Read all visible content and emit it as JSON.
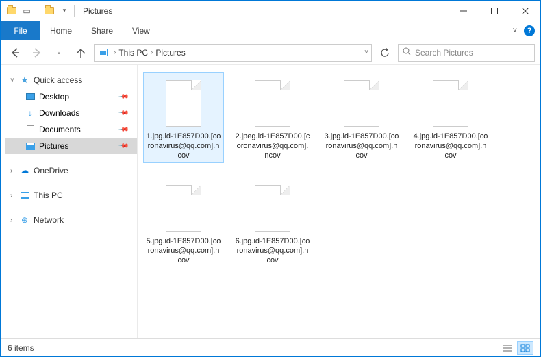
{
  "titlebar": {
    "title": "Pictures",
    "separator": "|"
  },
  "ribbon": {
    "file": "File",
    "tabs": [
      "Home",
      "Share",
      "View"
    ]
  },
  "breadcrumb": {
    "parts": [
      "This PC",
      "Pictures"
    ],
    "sep": "›"
  },
  "search": {
    "placeholder": "Search Pictures"
  },
  "sidebar": {
    "quick_access": "Quick access",
    "items": [
      {
        "label": "Desktop",
        "pinned": true
      },
      {
        "label": "Downloads",
        "pinned": true
      },
      {
        "label": "Documents",
        "pinned": true
      },
      {
        "label": "Pictures",
        "pinned": true,
        "selected": true
      }
    ],
    "onedrive": "OneDrive",
    "this_pc": "This PC",
    "network": "Network"
  },
  "files": [
    {
      "name": "1.jpg.id-1E857D00.[coronavirus@qq.com].ncov",
      "selected": true
    },
    {
      "name": "2.jpeg.id-1E857D00.[coronavirus@qq.com].ncov"
    },
    {
      "name": "3.jpg.id-1E857D00.[coronavirus@qq.com].ncov"
    },
    {
      "name": "4.jpg.id-1E857D00.[coronavirus@qq.com].ncov"
    },
    {
      "name": "5.jpg.id-1E857D00.[coronavirus@qq.com].ncov"
    },
    {
      "name": "6.jpg.id-1E857D00.[coronavirus@qq.com].ncov"
    }
  ],
  "statusbar": {
    "count": "6 items"
  }
}
